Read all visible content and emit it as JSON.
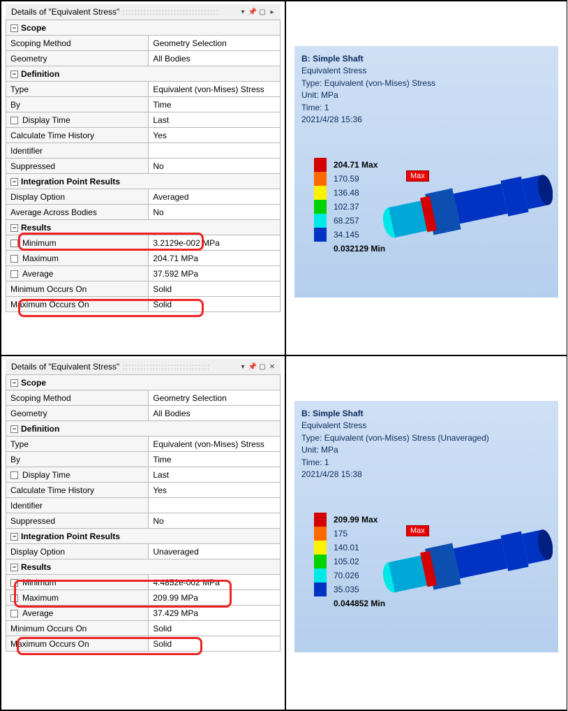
{
  "top": {
    "panel": {
      "title": "Details of \"Equivalent Stress\"",
      "sections": {
        "scope_hdr": "Scope",
        "scoping_method_l": "Scoping Method",
        "scoping_method_v": "Geometry Selection",
        "geometry_l": "Geometry",
        "geometry_v": "All Bodies",
        "def_hdr": "Definition",
        "type_l": "Type",
        "type_v": "Equivalent (von-Mises) Stress",
        "by_l": "By",
        "by_v": "Time",
        "disp_time_l": "Display Time",
        "disp_time_v": "Last",
        "calc_hist_l": "Calculate Time History",
        "calc_hist_v": "Yes",
        "ident_l": "Identifier",
        "ident_v": "",
        "supp_l": "Suppressed",
        "supp_v": "No",
        "ipr_hdr": "Integration Point Results",
        "disp_opt_l": "Display Option",
        "disp_opt_v": "Averaged",
        "avg_across_l": "Average Across Bodies",
        "avg_across_v": "No",
        "res_hdr": "Results",
        "min_l": "Minimum",
        "min_v": "3.2129e-002 MPa",
        "max_l": "Maximum",
        "max_v": "204.71 MPa",
        "avg_l": "Average",
        "avg_v": "37.592 MPa",
        "minon_l": "Minimum Occurs On",
        "minon_v": "Solid",
        "maxon_l": "Maximum Occurs On",
        "maxon_v": "Solid"
      }
    },
    "viz": {
      "name": "B: Simple Shaft",
      "result": "Equivalent Stress",
      "type": "Type: Equivalent (von-Mises) Stress",
      "unit": "Unit: MPa",
      "time": "Time: 1",
      "date": "2021/4/28 15:36",
      "max": "204.71 Max",
      "l1": "170.59",
      "l2": "136.48",
      "l3": "102.37",
      "l4": "68.257",
      "l5": "34.145",
      "min": "0.032129 Min",
      "maxlabel": "Max"
    }
  },
  "bottom": {
    "panel": {
      "title": "Details of \"Equivalent Stress\"",
      "sections": {
        "scope_hdr": "Scope",
        "scoping_method_l": "Scoping Method",
        "scoping_method_v": "Geometry Selection",
        "geometry_l": "Geometry",
        "geometry_v": "All Bodies",
        "def_hdr": "Definition",
        "type_l": "Type",
        "type_v": "Equivalent (von-Mises) Stress",
        "by_l": "By",
        "by_v": "Time",
        "disp_time_l": "Display Time",
        "disp_time_v": "Last",
        "calc_hist_l": "Calculate Time History",
        "calc_hist_v": "Yes",
        "ident_l": "Identifier",
        "ident_v": "",
        "supp_l": "Suppressed",
        "supp_v": "No",
        "ipr_hdr": "Integration Point Results",
        "disp_opt_l": "Display Option",
        "disp_opt_v": "Unaveraged",
        "res_hdr": "Results",
        "min_l": "Minimum",
        "min_v": "4.4852e-002 MPa",
        "max_l": "Maximum",
        "max_v": "209.99 MPa",
        "avg_l": "Average",
        "avg_v": "37.429 MPa",
        "minon_l": "Minimum Occurs On",
        "minon_v": "Solid",
        "maxon_l": "Maximum Occurs On",
        "maxon_v": "Solid"
      }
    },
    "viz": {
      "name": "B: Simple Shaft",
      "result": "Equivalent Stress",
      "type": "Type: Equivalent (von-Mises) Stress (Unaveraged)",
      "unit": "Unit: MPa",
      "time": "Time: 1",
      "date": "2021/4/28 15:38",
      "max": "209.99 Max",
      "l1": "175",
      "l2": "140.01",
      "l3": "105.02",
      "l4": "70.026",
      "l5": "35.035",
      "min": "0.044852 Min",
      "maxlabel": "Max"
    }
  },
  "icons": {
    "expand": "▾",
    "pin": "📌",
    "square": "▢",
    "chevright": "▸",
    "close": "✕",
    "collapse_minus": "−"
  }
}
